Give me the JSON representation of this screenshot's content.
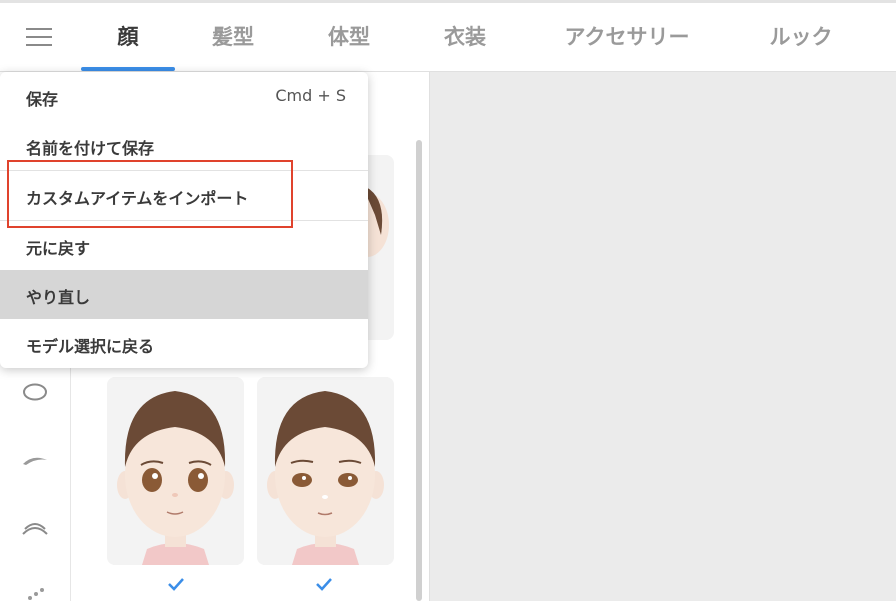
{
  "tabs": [
    {
      "label": "顔",
      "active": true
    },
    {
      "label": "髪型"
    },
    {
      "label": "体型"
    },
    {
      "label": "衣装"
    },
    {
      "label": "アクセサリー"
    },
    {
      "label": "ルック"
    }
  ],
  "menu": {
    "items": [
      {
        "label": "保存",
        "shortcut": "Cmd + S"
      },
      {
        "label": "名前を付けて保存"
      },
      {
        "label": "カスタムアイテムをインポート",
        "highlighted": true
      },
      {
        "label": "元に戻す"
      },
      {
        "label": "やり直し",
        "hovered": true
      },
      {
        "label": "モデル選択に戻る"
      }
    ]
  },
  "sidebar": {
    "icons": [
      "face-outline-icon",
      "eyebrow-icon",
      "eye-icon",
      "more-icon"
    ]
  },
  "cards": [
    {
      "name": "face-preset-1",
      "selected": true
    },
    {
      "name": "face-preset-2",
      "selected": true
    }
  ],
  "colors": {
    "accent": "#3b8ee8",
    "highlight_box": "#e0432d",
    "hover_row": "#d6d6d6",
    "right_panel": "#ebebeb"
  }
}
